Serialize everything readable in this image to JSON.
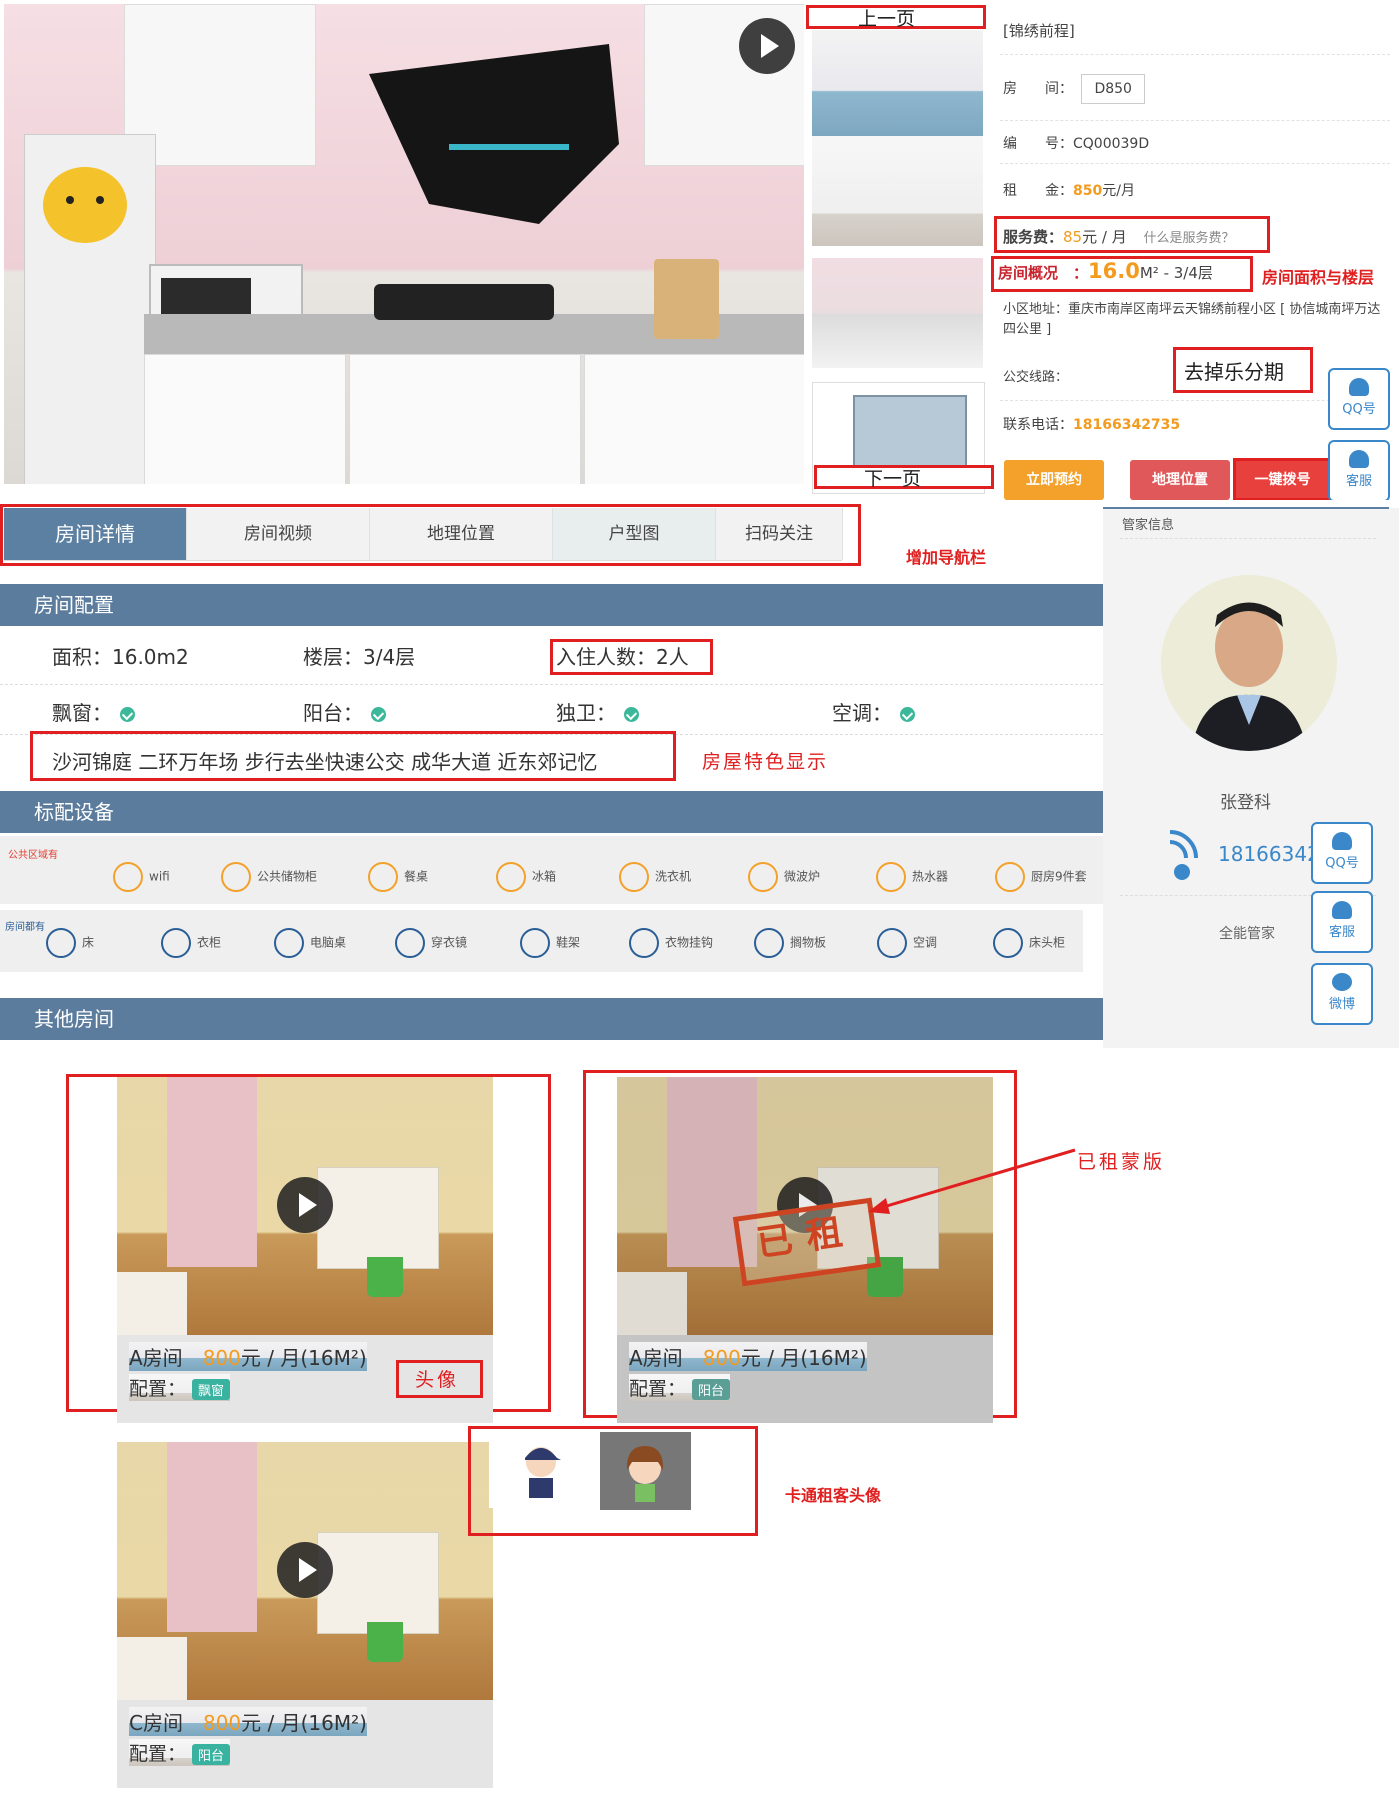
{
  "gallery": {
    "prev_label": "上一页",
    "next_label": "下一页"
  },
  "info": {
    "title": "[锦绣前程]",
    "room_label": "房　　间：",
    "room_value": "D850",
    "code_label": "编　　号：",
    "code_value": "CQ00039D",
    "rent_label": "租　　金：",
    "rent_value": "850",
    "rent_unit": "元/月",
    "fee_label": "服务费：",
    "fee_value": "85",
    "fee_unit": "元 / 月",
    "fee_help": "什么是服务费？",
    "overview_label": "房间概况　：",
    "overview_area": "16.0",
    "overview_rest": "M² - 3/4层",
    "address": "小区地址：重庆市南岸区南坪云天锦绣前程小区 [ 协信城南坪万达四公里 ]",
    "bus_label": "公交线路：",
    "phone_label": "联系电话：",
    "phone_value": "18166342735",
    "btn_book": "立即预约",
    "btn_location": "地理位置",
    "btn_call": "一键拨号"
  },
  "annotations": {
    "area_floor": "房间面积与楼层",
    "remove_installment": "去掉乐分期",
    "add_nav": "增加导航栏",
    "feature_show": "房屋特色显示",
    "rented_mask": "已租蒙版",
    "avatar": "头像",
    "cartoon_avatar": "卡通租客头像"
  },
  "tabs": [
    "房间详情",
    "房间视频",
    "地理位置",
    "户型图",
    "扫码关注"
  ],
  "config": {
    "section_title": "房间配置",
    "area": "面积：16.0m2",
    "floor": "楼层：3/4层",
    "occupants": "入住人数：2人",
    "bay_window": "飘窗：",
    "balcony": "阳台：",
    "bathroom": "独卫：",
    "aircon": "空调：",
    "features": "沙河锦庭 二环万年场 步行去坐快速公交 成华大道 近东郊记忆"
  },
  "equipment": {
    "section_title": "标配设备",
    "public_label": "公共区域有",
    "public_items": [
      "wifi",
      "公共储物柜",
      "餐桌",
      "冰箱",
      "洗衣机",
      "微波炉",
      "热水器",
      "厨房9件套"
    ],
    "room_label": "房间都有",
    "room_items": [
      "床",
      "衣柜",
      "电脑桌",
      "穿衣镜",
      "鞋架",
      "衣物挂钩",
      "搁物板",
      "空调",
      "床头柜"
    ]
  },
  "others": {
    "section_title": "其他房间",
    "rooms": [
      {
        "name": "A房间",
        "price": "800",
        "unit": "元 / 月(16M²)",
        "cfg_label": "配置：",
        "tag": "飘窗"
      },
      {
        "name": "A房间",
        "price": "800",
        "unit": "元 / 月(16M²)",
        "cfg_label": "配置：",
        "tag": "阳台",
        "stamp": "已租"
      },
      {
        "name": "C房间",
        "price": "800",
        "unit": "元 / 月(16M²)",
        "cfg_label": "配置：",
        "tag": "阳台"
      }
    ]
  },
  "manager": {
    "panel_title": "管家信息",
    "name": "张登科",
    "phone": "18166342735",
    "role": "全能管家"
  },
  "side": {
    "qq": "QQ号",
    "service": "客服",
    "weibo": "微博"
  },
  "colors": {
    "accent_orange": "#f29b1f",
    "section_blue": "#5b7c9d",
    "annotation_red": "#e02020",
    "tag_green": "#3ab2a0"
  }
}
